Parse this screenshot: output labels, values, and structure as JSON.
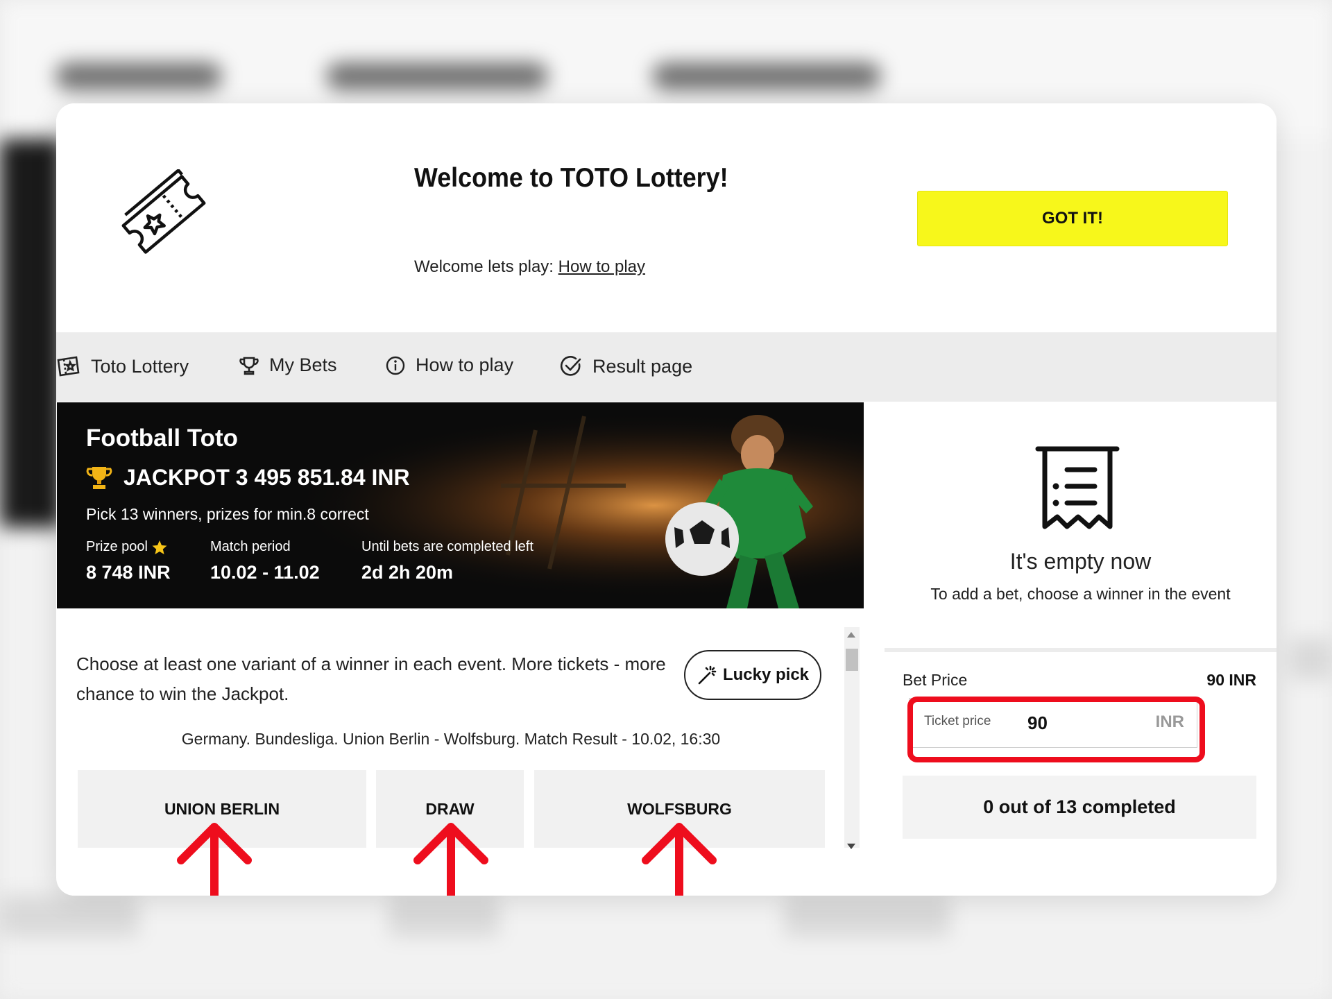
{
  "welcome": {
    "title": "Welcome to TOTO Lottery!",
    "subtitle_prefix": "Welcome lets play: ",
    "subtitle_link": "How to play",
    "got_it_label": "GOT IT!"
  },
  "tabs": [
    {
      "label": "Toto Lottery",
      "icon": "ticket-icon"
    },
    {
      "label": "My Bets",
      "icon": "trophy-icon"
    },
    {
      "label": "How to play",
      "icon": "info-icon"
    },
    {
      "label": "Result page",
      "icon": "check-circle-icon"
    }
  ],
  "banner": {
    "title": "Football Toto",
    "jackpot": "JACKPOT 3 495 851.84 INR",
    "pick_text": "Pick 13 winners, prizes for min.8 correct",
    "stats": [
      {
        "label": "Prize pool",
        "value": "8 748 INR"
      },
      {
        "label": "Match period",
        "value": "10.02 - 11.02"
      },
      {
        "label": "Until bets are completed left",
        "value": "2d 2h 20m"
      }
    ]
  },
  "events": {
    "description": "Choose at least one variant of a winner in each event. More tickets - more chance to win the Jackpot.",
    "lucky_pick_label": "Lucky pick",
    "match_info": "Germany. Bundesliga. Union Berlin - Wolfsburg. Match Result - 10.02, 16:30",
    "choices": [
      "UNION BERLIN",
      "DRAW",
      "WOLFSBURG"
    ]
  },
  "betslip": {
    "empty_title": "It's empty now",
    "empty_subtitle": "To add a bet, choose a winner in the event",
    "bet_price_label": "Bet Price",
    "bet_price_value": "90 INR",
    "ticket_price_label": "Ticket price",
    "ticket_price_value": "90",
    "ticket_currency": "INR",
    "completed_text": "0 out of 13 completed"
  },
  "colors": {
    "accent_yellow": "#f7f71b",
    "highlight_red": "#ee0d1d",
    "banner_bg": "#0b0b0b"
  }
}
